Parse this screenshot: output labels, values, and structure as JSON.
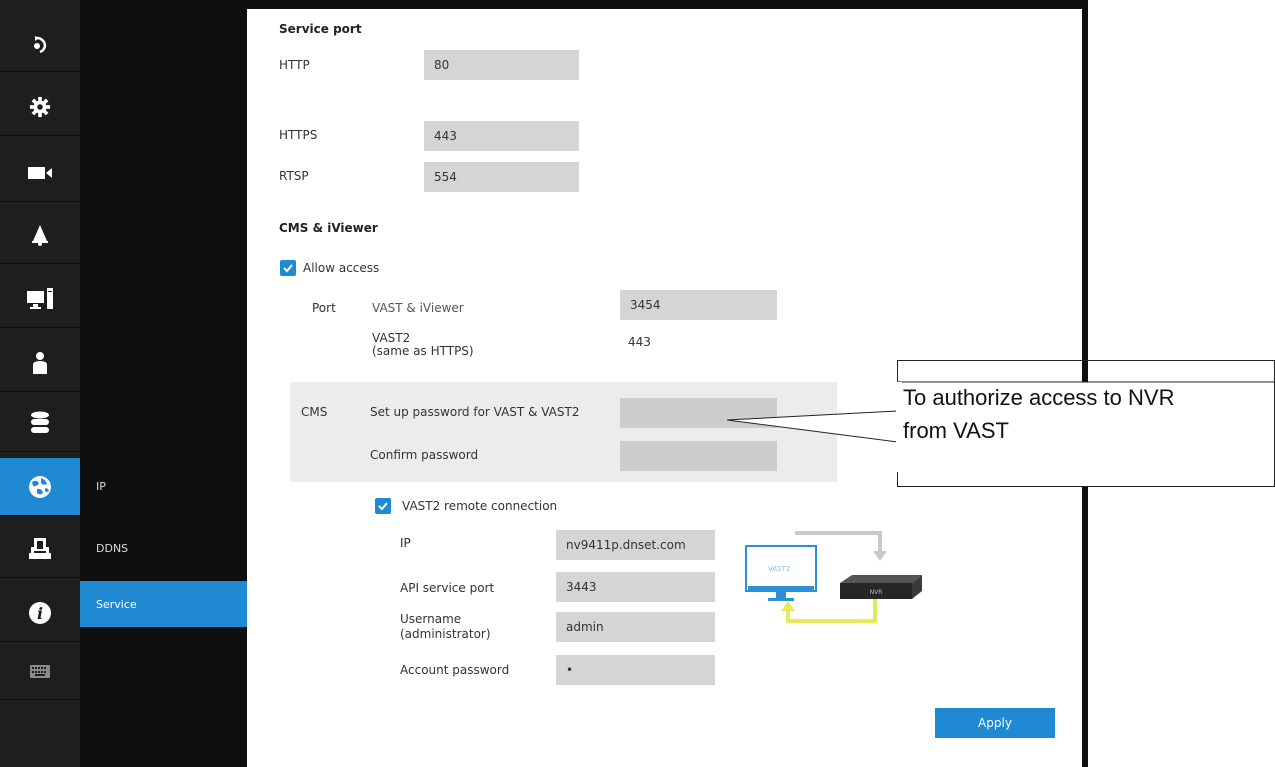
{
  "icon_bar": [
    "home-icon",
    "gear-icon",
    "camera-icon",
    "bell-icon",
    "computer-icon",
    "user-icon",
    "database-icon",
    "network-icon",
    "security-icon",
    "info-icon",
    "keyboard-icon"
  ],
  "subnav": {
    "items": [
      "IP",
      "DDNS",
      "Service"
    ],
    "active": "Service"
  },
  "service_port": {
    "title": "Service port",
    "http_label": "HTTP",
    "http_value": "80",
    "https_label": "HTTPS",
    "https_value": "443",
    "rtsp_label": "RTSP",
    "rtsp_value": "554"
  },
  "cms": {
    "title": "CMS & iViewer",
    "allow_access": "Allow access",
    "port_label": "Port",
    "vast_iviewer_label": "VAST & iViewer",
    "vast_iviewer_value": "3454",
    "vast2_label_line1": "VAST2",
    "vast2_label_line2": "(same as HTTPS)",
    "vast2_value": "443",
    "cms_label": "CMS",
    "setup_password_label": "Set up password for VAST & VAST2",
    "confirm_password_label": "Confirm password"
  },
  "vast2_remote": {
    "checkbox_label": "VAST2 remote connection",
    "ip_label": "IP",
    "ip_value": "nv9411p.dnset.com",
    "api_port_label": "API service port",
    "api_port_value": "3443",
    "username_label_line1": "Username",
    "username_label_line2": "(administrator)",
    "username_value": "admin",
    "account_password_label": "Account password",
    "account_password_value": "•"
  },
  "diagram": {
    "vast_label": "VAST2",
    "nvr_label": "NVR"
  },
  "apply_label": "Apply",
  "callout": {
    "line1": "To authorize access to NVR",
    "line2": "from VAST"
  },
  "colors": {
    "accent": "#1f8ad3",
    "field": "#d5d5d5",
    "dark": "#1e1e1e",
    "diagram_arrow": "#e4ea5a"
  }
}
